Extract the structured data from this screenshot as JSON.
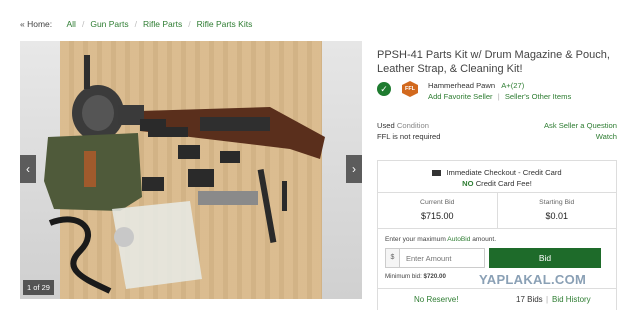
{
  "breadcrumb": {
    "home": "« Home:",
    "items": [
      "All",
      "Gun Parts",
      "Rifle Parts",
      "Rifle Parts Kits"
    ]
  },
  "gallery": {
    "counter": "1 of 29",
    "prev_icon": "chevron-left-icon",
    "next_icon": "chevron-right-icon"
  },
  "listing": {
    "title": "PPSH-41 Parts Kit w/ Drum Magazine & Pouch, Leather Strap, & Cleaning Kit!"
  },
  "seller": {
    "name": "Hammerhead Pawn",
    "rating": "A+(27)",
    "ffl_badge": "FFL",
    "add_favorite": "Add Favorite Seller",
    "other_items": "Seller's Other Items"
  },
  "condition": {
    "value": "Used",
    "label": "Condition",
    "ffl_note": "FFL is not required"
  },
  "actions": {
    "ask_question": "Ask Seller a Question",
    "watch": "Watch"
  },
  "bidbox": {
    "checkout": "Immediate Checkout - Credit Card",
    "no_fee_strong": "NO",
    "no_fee_rest": "Credit Card Fee!",
    "current_bid_label": "Current Bid",
    "current_bid": "$715.00",
    "starting_bid_label": "Starting Bid",
    "starting_bid": "$0.01",
    "enter_label_pre": "Enter your maximum",
    "enter_label_link": "AutoBid",
    "enter_label_post": "amount.",
    "dollar": "$",
    "amount_placeholder": "Enter Amount",
    "bid_button": "Bid",
    "min_bid_label": "Minimum bid:",
    "min_bid": "$720.00",
    "no_reserve": "No Reserve!",
    "bids_count": "17 Bids",
    "bid_history": "Bid History"
  },
  "watermark": "YAPLAKAL.COM",
  "colors": {
    "accent_green": "#2e7d32",
    "button_green": "#1e6b2a",
    "ffl_orange": "#d2691e"
  }
}
